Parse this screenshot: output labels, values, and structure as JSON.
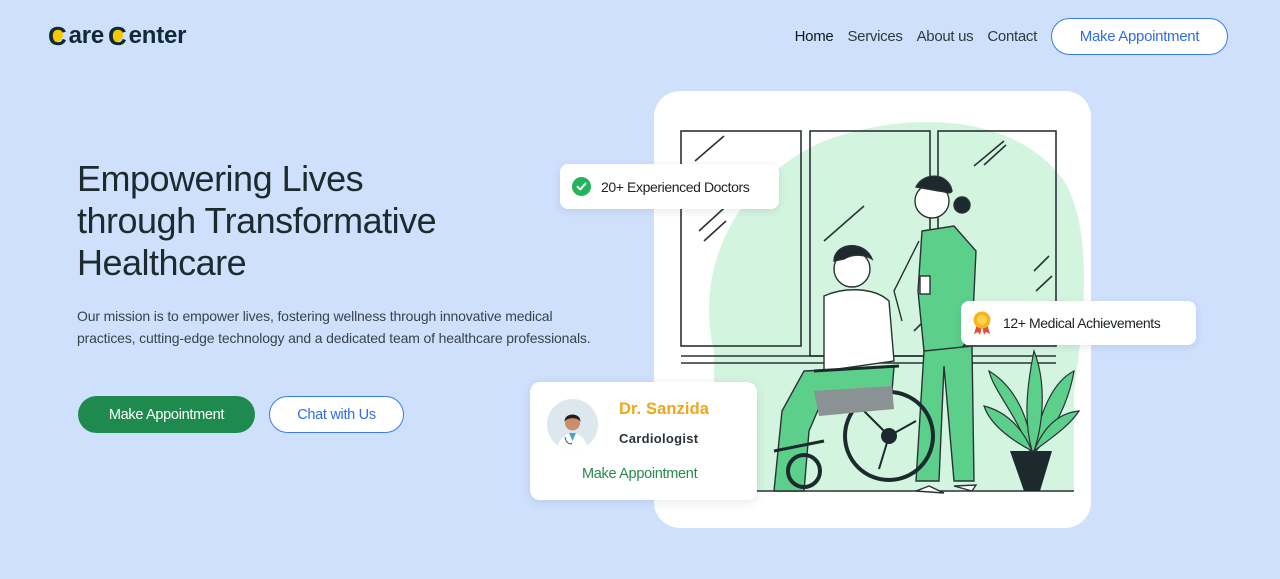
{
  "brand": {
    "logo_letter_1": "C",
    "logo_word_1": "are",
    "logo_letter_2": "C",
    "logo_word_2": "enter",
    "accent": "#f5c800"
  },
  "nav": {
    "items": [
      "Home",
      "Services",
      "About us",
      "Contact"
    ],
    "active": "Home",
    "cta_label": "Make Appointment"
  },
  "hero": {
    "title": "Empowering Lives\nthrough Transformative\nHealthcare",
    "description": "Our mission is to empower lives, fostering wellness through innovative medical practices, cutting-edge technology and a dedicated team of healthcare professionals.",
    "primary_cta": "Make Appointment",
    "secondary_cta": "Chat with Us"
  },
  "stats": {
    "doctors": "20+ Experienced Doctors",
    "doctors_icon": "check-circle-icon",
    "achievements": "12+ Medical Achievements",
    "achievements_icon": "medal-icon"
  },
  "doctor_card": {
    "name": "Dr. Sanzida",
    "role": "Cardiologist",
    "link": "Make Appointment"
  },
  "colors": {
    "background": "#cfe0fd",
    "primary_green": "#1f8a4d",
    "link_blue": "#2f6ee8",
    "doctor_name": "#f2a516",
    "illustration_green": "#5ccf8b"
  }
}
